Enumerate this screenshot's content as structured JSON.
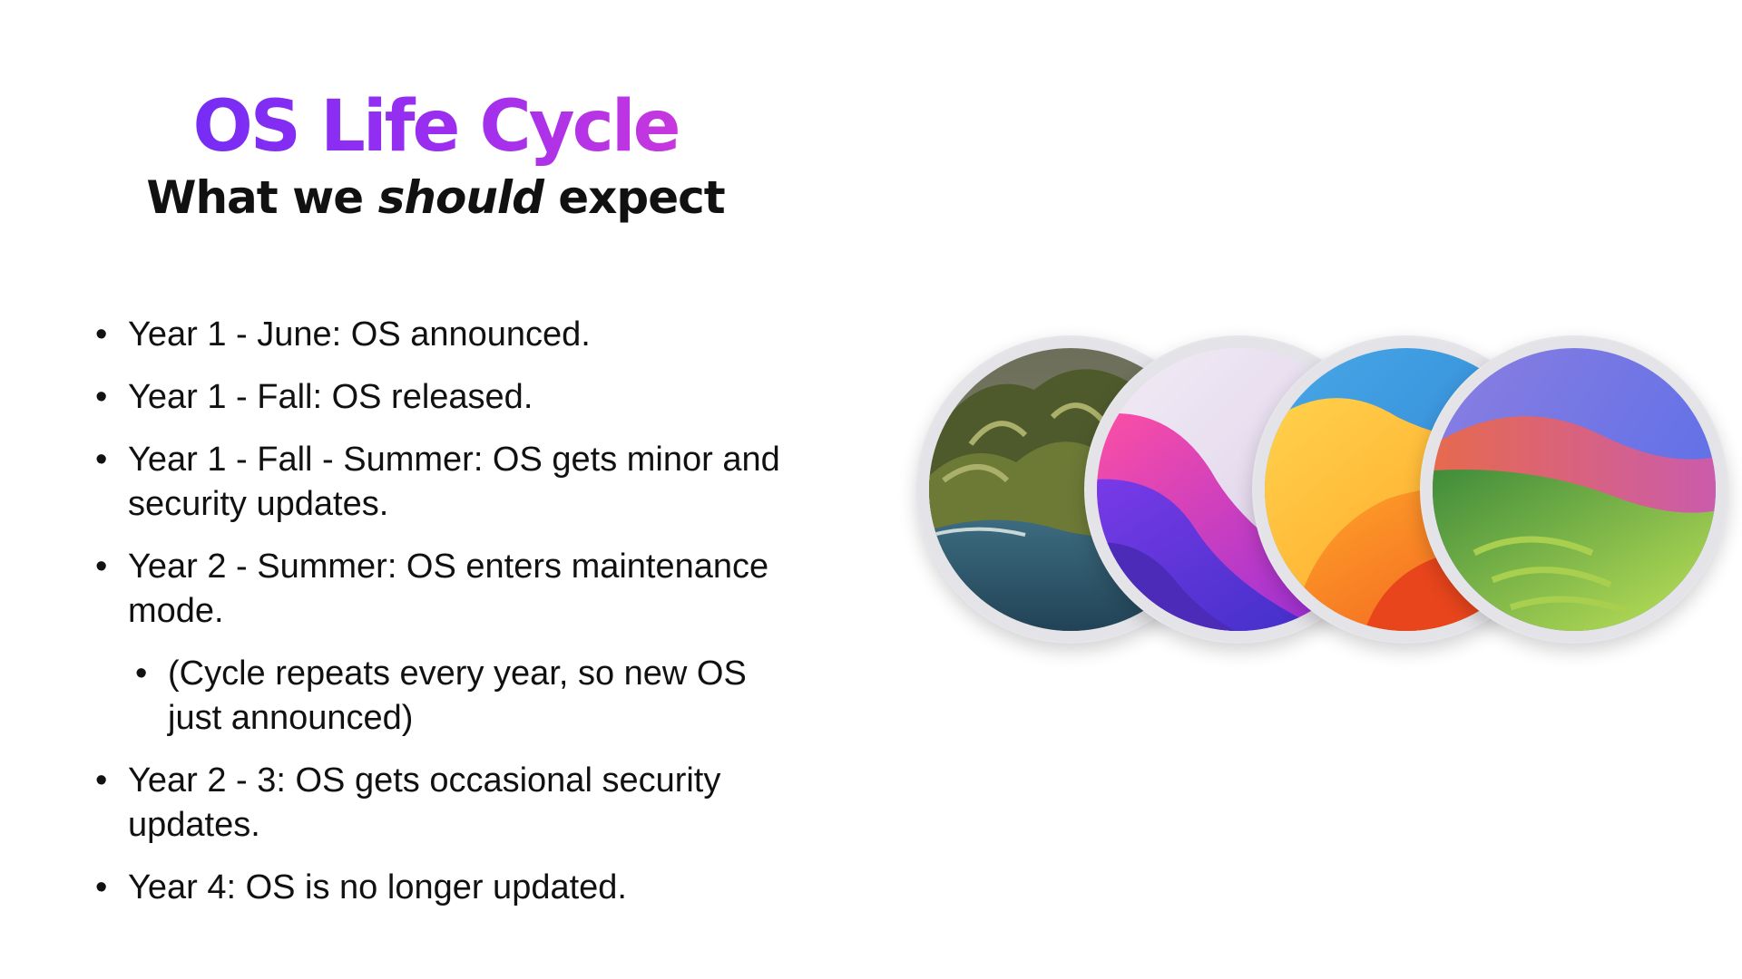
{
  "slide": {
    "title": "OS Life Cycle",
    "subtitle_before": "What we ",
    "subtitle_emphasis": "should",
    "subtitle_after": " expect"
  },
  "bullets": [
    {
      "text": "Year 1 - June: OS announced.",
      "level": 1
    },
    {
      "text": "Year 1 - Fall: OS released.",
      "level": 1
    },
    {
      "text": "Year 1 - Fall - Summer: OS gets minor and security updates.",
      "level": 1
    },
    {
      "text": "Year 2 - Summer: OS enters maintenance mode.",
      "level": 1
    },
    {
      "text": "(Cycle repeats every year, so new OS just announced)",
      "level": 2
    },
    {
      "text": "Year 2 - 3: OS gets occasional security updates.",
      "level": 1
    },
    {
      "text": "Year 4: OS is no longer updated.",
      "level": 1
    }
  ],
  "bullet_glyph": "•",
  "colors": {
    "title_gradient_start": "#6a2cf5",
    "title_gradient_end": "#d63ad8",
    "text": "#111111",
    "background": "#ffffff"
  },
  "images": [
    {
      "name": "coastal-mountains-wallpaper"
    },
    {
      "name": "purple-waves-wallpaper"
    },
    {
      "name": "orange-waves-wallpaper"
    },
    {
      "name": "green-hills-wallpaper"
    }
  ]
}
